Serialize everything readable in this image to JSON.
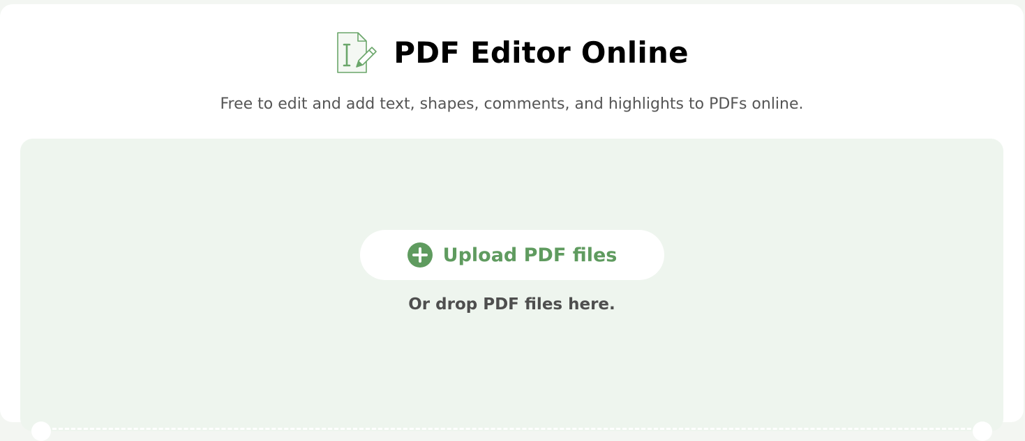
{
  "header": {
    "icon": "pdf-edit-icon",
    "title": "PDF Editor Online",
    "subtitle": "Free to edit and add text, shapes, comments, and highlights to PDFs online."
  },
  "upload": {
    "icon": "plus-circle-icon",
    "button_label": "Upload PDF files",
    "drop_hint": "Or drop PDF files here."
  },
  "colors": {
    "accent": "#5f9b5f",
    "drop_zone_bg": "#eef5ee",
    "page_bg": "#f3f6f2",
    "title_text": "#000000",
    "subtitle_text": "#555555"
  }
}
